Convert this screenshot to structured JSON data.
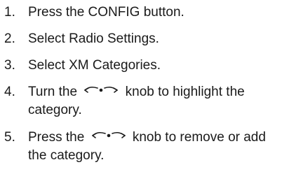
{
  "steps": [
    {
      "number": "1.",
      "text": "Press the CONFIG button."
    },
    {
      "number": "2.",
      "text": "Select Radio Settings."
    },
    {
      "number": "3.",
      "text": "Select XM Categories."
    },
    {
      "number": "4.",
      "before": "Turn the",
      "after": "knob to highlight the category.",
      "icon": "tune-knob-icon"
    },
    {
      "number": "5.",
      "before": "Press the",
      "after": "knob to remove or add the category.",
      "icon": "tune-knob-icon"
    }
  ]
}
